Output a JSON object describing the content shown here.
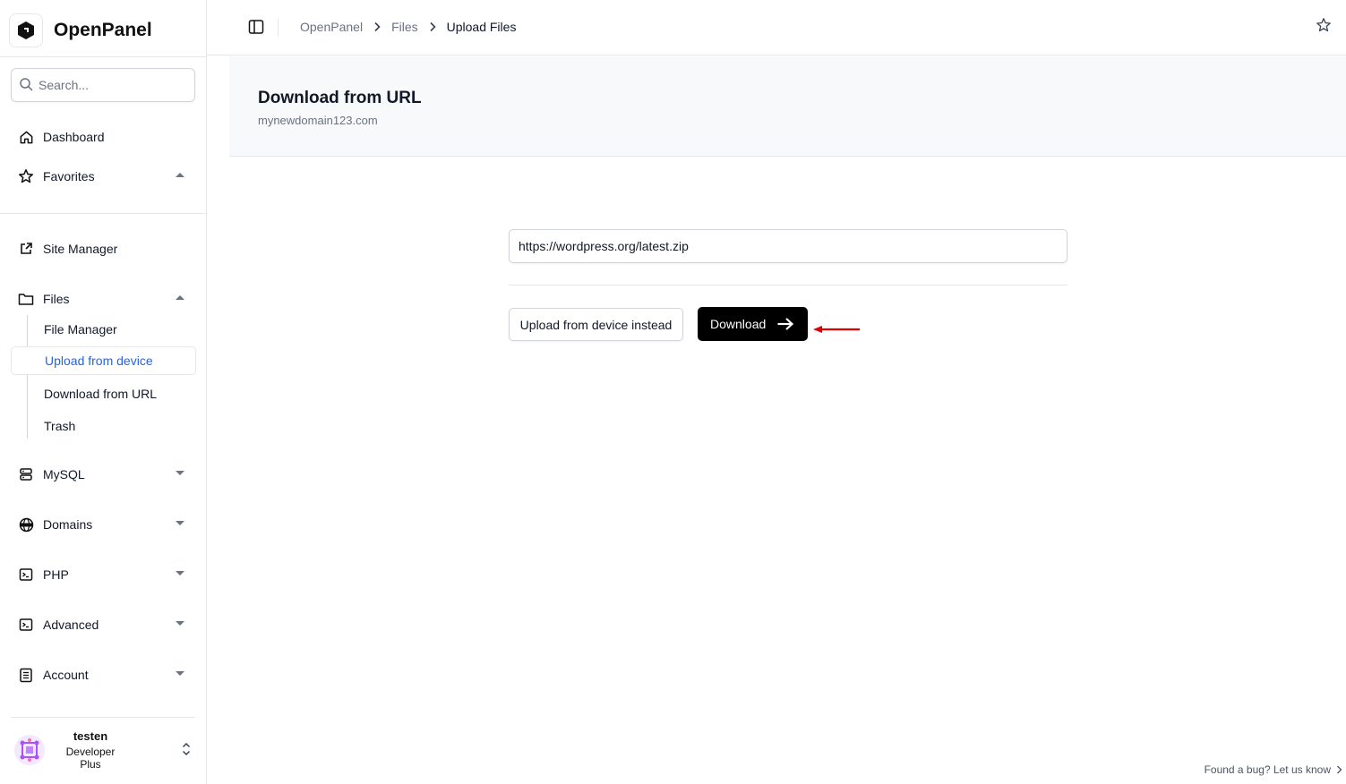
{
  "app": {
    "name": "OpenPanel"
  },
  "search": {
    "placeholder": "Search..."
  },
  "sidebar": {
    "dashboard": "Dashboard",
    "favorites": "Favorites",
    "site_manager": "Site Manager",
    "files": "Files",
    "files_sub": [
      "File Manager",
      "Upload from device",
      "Download from URL",
      "Trash"
    ],
    "mysql": "MySQL",
    "domains": "Domains",
    "php": "PHP",
    "advanced": "Advanced",
    "account": "Account"
  },
  "user": {
    "name": "testen",
    "plan": "Developer Plus"
  },
  "breadcrumb": [
    "OpenPanel",
    "Files",
    "Upload Files"
  ],
  "page": {
    "title": "Download from URL",
    "subtitle": "mynewdomain123.com"
  },
  "form": {
    "url_value": "https://wordpress.org/latest.zip",
    "upload_button": "Upload from device instead",
    "download_button": "Download"
  },
  "footer": {
    "bug_link": "Found a bug? Let us know"
  },
  "colors": {
    "accent": "#2563eb",
    "primary_button": "#000000",
    "annotation": "#e00000"
  }
}
